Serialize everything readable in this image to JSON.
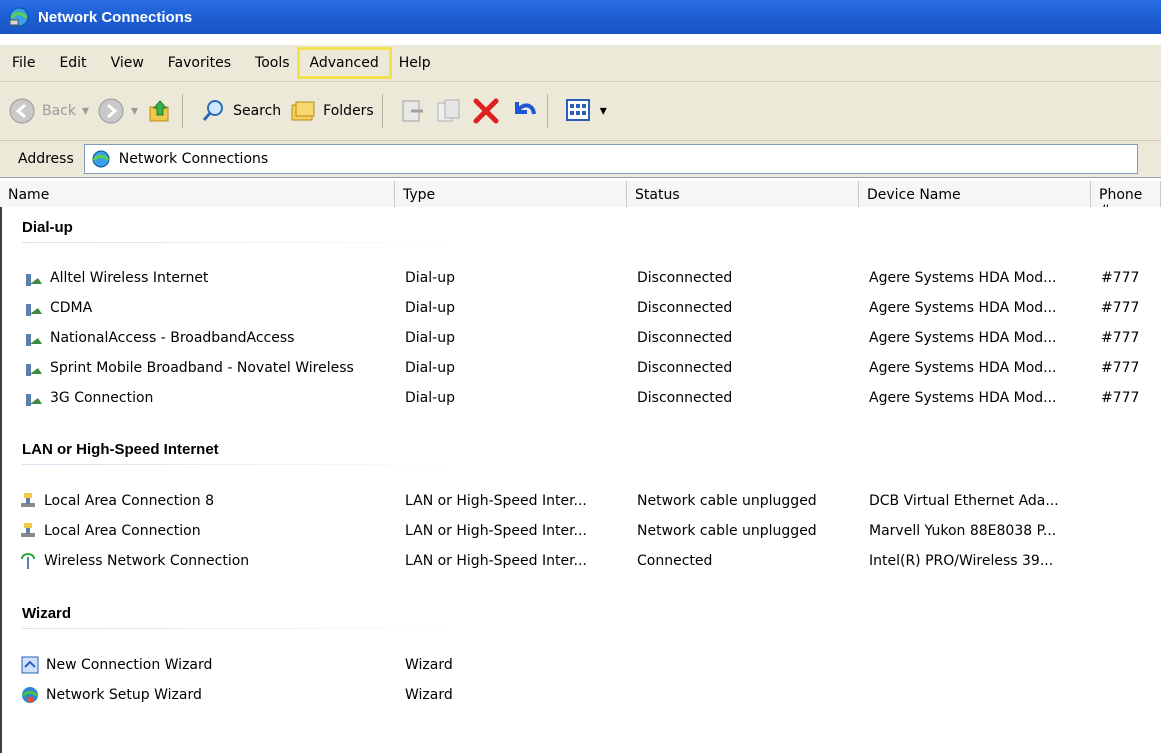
{
  "window": {
    "title": "Network Connections"
  },
  "menu": [
    "File",
    "Edit",
    "View",
    "Favorites",
    "Tools",
    "Advanced",
    "Help"
  ],
  "toolbar": {
    "back": "Back",
    "search": "Search",
    "folders": "Folders"
  },
  "address": {
    "label": "Address",
    "value": "Network Connections"
  },
  "columns": [
    "Name",
    "Type",
    "Status",
    "Device Name",
    "Phone #"
  ],
  "groups": [
    {
      "label": "Dial-up"
    },
    {
      "label": "LAN or High-Speed Internet"
    },
    {
      "label": "Wizard"
    }
  ],
  "rows": [
    {
      "name": "Alltel Wireless Internet",
      "type": "Dial-up",
      "status": "Disconnected",
      "device": "Agere Systems HDA Mod...",
      "phone": "#777",
      "icon": "dialup-icon"
    },
    {
      "name": "CDMA",
      "type": "Dial-up",
      "status": "Disconnected",
      "device": "Agere Systems HDA Mod...",
      "phone": "#777",
      "icon": "dialup-icon"
    },
    {
      "name": "NationalAccess - BroadbandAccess",
      "type": "Dial-up",
      "status": "Disconnected",
      "device": "Agere Systems HDA Mod...",
      "phone": "#777",
      "icon": "dialup-icon"
    },
    {
      "name": "Sprint Mobile Broadband - Novatel Wireless",
      "type": "Dial-up",
      "status": "Disconnected",
      "device": "Agere Systems HDA Mod...",
      "phone": "#777",
      "icon": "dialup-icon"
    },
    {
      "name": "3G Connection",
      "type": "Dial-up",
      "status": "Disconnected",
      "device": "Agere Systems HDA Mod...",
      "phone": "#777",
      "icon": "dialup-icon"
    },
    {
      "name": "Local Area Connection 8",
      "type": "LAN or High-Speed Inter...",
      "status": "Network cable unplugged",
      "device": "DCB Virtual Ethernet Ada...",
      "phone": "",
      "icon": "lan-icon"
    },
    {
      "name": "Local Area Connection",
      "type": "LAN or High-Speed Inter...",
      "status": "Network cable unplugged",
      "device": "Marvell Yukon 88E8038 P...",
      "phone": "",
      "icon": "lan-icon"
    },
    {
      "name": "Wireless Network Connection",
      "type": "LAN or High-Speed Inter...",
      "status": "Connected",
      "device": "Intel(R) PRO/Wireless 39...",
      "phone": "",
      "icon": "wireless-icon"
    },
    {
      "name": "New Connection Wizard",
      "type": "Wizard",
      "status": "",
      "device": "",
      "phone": "",
      "icon": "new-connection-wizard-icon"
    },
    {
      "name": "Network Setup Wizard",
      "type": "Wizard",
      "status": "",
      "device": "",
      "phone": "",
      "icon": "network-setup-wizard-icon"
    }
  ],
  "colors": {
    "titlebar": "#1e5fd4",
    "chrome": "#ece9d8",
    "highlight": "#f4e04d",
    "delete": "#e02020"
  }
}
